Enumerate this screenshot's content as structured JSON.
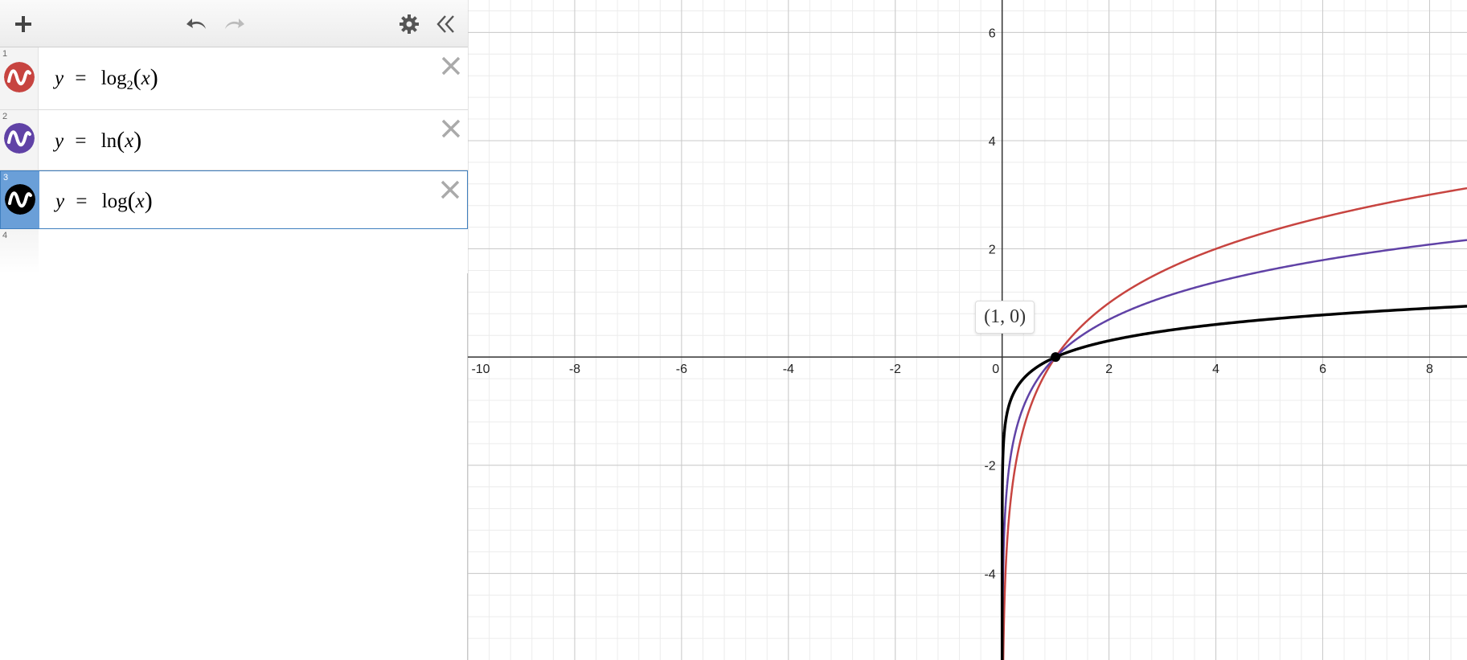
{
  "toolbar": {
    "add_icon": "plus-icon",
    "undo_icon": "undo-icon",
    "redo_icon": "redo-icon",
    "settings_icon": "gear-icon",
    "collapse_icon": "double-chevron-left-icon"
  },
  "expressions": [
    {
      "index": "1",
      "lhs": "y",
      "eq": "=",
      "fn": "log",
      "sub": "2",
      "arg": "x",
      "color": "#c74440",
      "selected": false
    },
    {
      "index": "2",
      "lhs": "y",
      "eq": "=",
      "fn": "ln",
      "sub": "",
      "arg": "x",
      "color": "#6042a6",
      "selected": false
    },
    {
      "index": "3",
      "lhs": "y",
      "eq": "=",
      "fn": "log",
      "sub": "",
      "arg": "x",
      "color": "#000000",
      "selected": true
    },
    {
      "index": "4"
    }
  ],
  "point_label": "(1, 0)",
  "graph": {
    "xlim": [
      -10,
      8.7
    ],
    "ylim": [
      -5.6,
      6.6
    ],
    "x_ticks": [
      "-10",
      "-8",
      "-6",
      "-4",
      "-2",
      "0",
      "2",
      "4",
      "6",
      "8"
    ],
    "y_ticks": [
      "6",
      "4",
      "2",
      "-2",
      "-4"
    ],
    "minor_grid": true
  },
  "chart_data": {
    "type": "line",
    "series": [
      {
        "expr": "log2(x)",
        "color": "#c74440",
        "points": [
          [
            0.02,
            -5.64
          ],
          [
            0.05,
            -4.32
          ],
          [
            0.1,
            -3.32
          ],
          [
            0.25,
            -2.0
          ],
          [
            0.5,
            -1.0
          ],
          [
            1,
            0
          ],
          [
            2,
            1
          ],
          [
            4,
            2
          ],
          [
            6,
            2.58
          ],
          [
            8,
            3.0
          ],
          [
            8.7,
            3.12
          ]
        ]
      },
      {
        "expr": "ln(x)",
        "color": "#6042a6",
        "points": [
          [
            0.004,
            -5.52
          ],
          [
            0.01,
            -4.61
          ],
          [
            0.05,
            -3.0
          ],
          [
            0.1,
            -2.3
          ],
          [
            0.25,
            -1.39
          ],
          [
            0.5,
            -0.69
          ],
          [
            1,
            0
          ],
          [
            2,
            0.69
          ],
          [
            4,
            1.39
          ],
          [
            6,
            1.79
          ],
          [
            8,
            2.08
          ],
          [
            8.7,
            2.16
          ]
        ]
      },
      {
        "expr": "log(x)",
        "color": "#000000",
        "points": [
          [
            3e-06,
            -5.52
          ],
          [
            0.001,
            -3.0
          ],
          [
            0.01,
            -2.0
          ],
          [
            0.1,
            -1.0
          ],
          [
            0.5,
            -0.3
          ],
          [
            1,
            0
          ],
          [
            2,
            0.3
          ],
          [
            4,
            0.6
          ],
          [
            6,
            0.78
          ],
          [
            8,
            0.9
          ],
          [
            8.7,
            0.94
          ]
        ]
      }
    ],
    "highlighted_point": [
      1,
      0
    ],
    "xlim": [
      -10,
      8.7
    ],
    "ylim": [
      -5.6,
      6.6
    ],
    "x_ticks": [
      -10,
      -8,
      -6,
      -4,
      -2,
      0,
      2,
      4,
      6,
      8
    ],
    "y_ticks": [
      6,
      4,
      2,
      -2,
      -4
    ],
    "grid": true
  }
}
